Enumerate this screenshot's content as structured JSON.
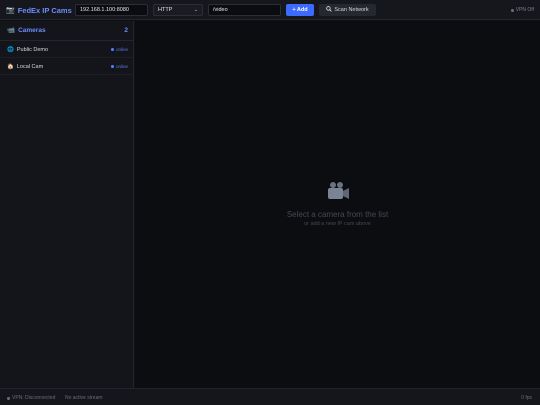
{
  "app": {
    "title": "FedEx IP Cams"
  },
  "toolbar": {
    "host_value": "192.168.1.100:8080",
    "protocol_selected": "HTTP",
    "path_value": "/video",
    "add_label": "+ Add",
    "scan_label": "Scan Network",
    "scan_icon": "search-icon",
    "vpn_label": "VPN Off"
  },
  "sidebar": {
    "title": "Cameras",
    "count": "2",
    "cameras": [
      {
        "name": "Public Demo",
        "icon": "globe-icon",
        "status": "online"
      },
      {
        "name": "Local Cam",
        "icon": "house-icon",
        "status": "online"
      }
    ]
  },
  "viewer": {
    "empty_title": "Select a camera from the list",
    "empty_subtitle": "or add a new IP cam above"
  },
  "statusbar": {
    "vpn_status": "VPN: Disconnected",
    "stream_status": "No active stream",
    "fps": "0 fps"
  },
  "colors": {
    "accent": "#6c8cff",
    "add_button": "#3d6bff",
    "background": "#0f1014",
    "online": "#4f7cff"
  }
}
